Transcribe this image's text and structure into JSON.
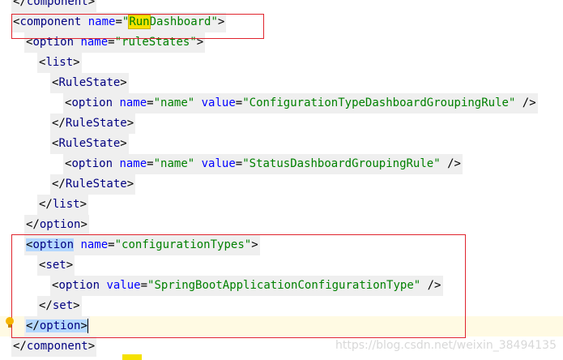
{
  "editor": {
    "lines": [
      {
        "indent": 0,
        "t": "close",
        "tag": "component"
      },
      {
        "indent": 0,
        "t": "open-comp",
        "tag": "component",
        "attr": "name",
        "val_hl": "Run",
        "val_rest": "Dashboard"
      },
      {
        "indent": 1,
        "t": "open-attr",
        "tag": "option",
        "attr": "name",
        "val": "ruleStates"
      },
      {
        "indent": 2,
        "t": "open",
        "tag": "list"
      },
      {
        "indent": 3,
        "t": "open",
        "tag": "RuleState"
      },
      {
        "indent": 4,
        "t": "self",
        "tag": "option",
        "a1": "name",
        "v1": "name",
        "a2": "value",
        "v2": "ConfigurationTypeDashboardGroupingRule"
      },
      {
        "indent": 3,
        "t": "close",
        "tag": "RuleState"
      },
      {
        "indent": 3,
        "t": "open",
        "tag": "RuleState"
      },
      {
        "indent": 4,
        "t": "self",
        "tag": "option",
        "a1": "name",
        "v1": "name",
        "a2": "value",
        "v2": "StatusDashboardGroupingRule"
      },
      {
        "indent": 3,
        "t": "close",
        "tag": "RuleState"
      },
      {
        "indent": 2,
        "t": "close",
        "tag": "list"
      },
      {
        "indent": 1,
        "t": "close",
        "tag": "option"
      },
      {
        "indent": 1,
        "t": "open-attr-hl",
        "tag": "option",
        "attr": "name",
        "val": "configurationTypes"
      },
      {
        "indent": 2,
        "t": "open",
        "tag": "set"
      },
      {
        "indent": 3,
        "t": "self1",
        "tag": "option",
        "a1": "value",
        "v1": "SpringBootApplicationConfigurationType"
      },
      {
        "indent": 2,
        "t": "close",
        "tag": "set"
      },
      {
        "indent": 1,
        "t": "close-hl",
        "tag": "option"
      },
      {
        "indent": 0,
        "t": "close",
        "tag": "component"
      }
    ]
  },
  "watermark": "https://blog.csdn.net/weixin_38494135",
  "colors": {
    "tag": "#000080",
    "attr": "#0000ff",
    "value": "#008000",
    "highlight_box": "#e0242d",
    "match_highlight": "#b3d7ff",
    "search_highlight": "#f5e100"
  },
  "icons": {
    "gutter": "intention-bulb-icon"
  }
}
